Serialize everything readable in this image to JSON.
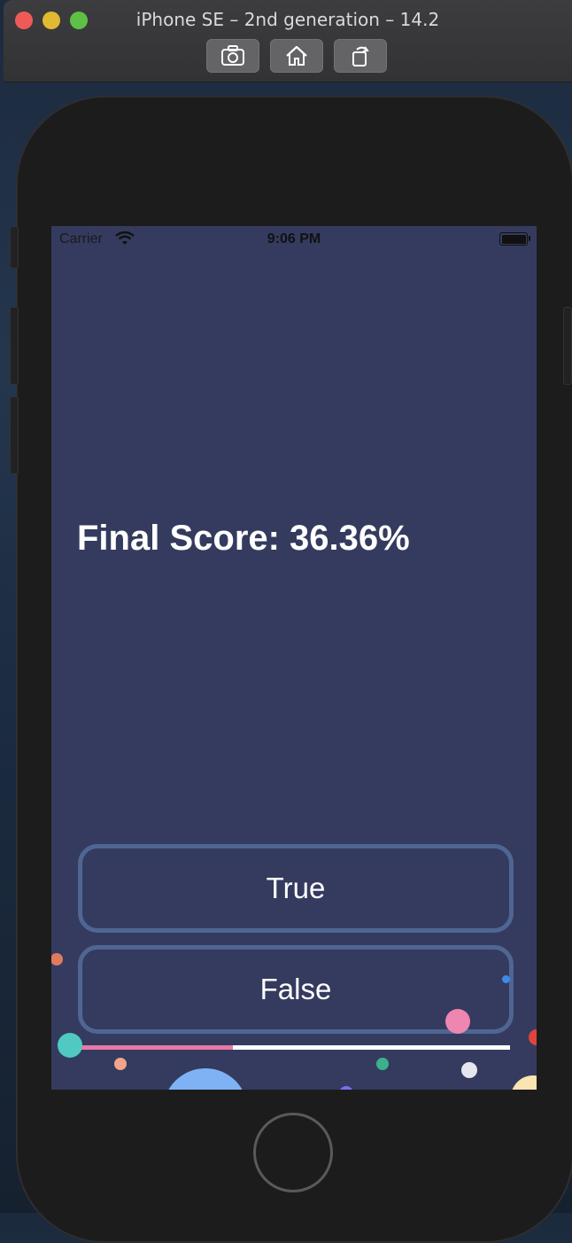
{
  "window": {
    "title": "iPhone SE – 2nd generation – 14.2",
    "toolbar": [
      "screenshot-icon",
      "home-icon",
      "rotate-icon"
    ]
  },
  "status_bar": {
    "carrier": "Carrier",
    "time": "9:06 PM"
  },
  "quiz": {
    "question_text": "Final Score: 36.36%",
    "answers": [
      "True",
      "False"
    ],
    "progress": 0.36
  },
  "colors": {
    "screen_bg": "#343b5e",
    "button_border": "#4f6693",
    "progress_fill": "#e679a6",
    "progress_track": "#ffffff"
  }
}
